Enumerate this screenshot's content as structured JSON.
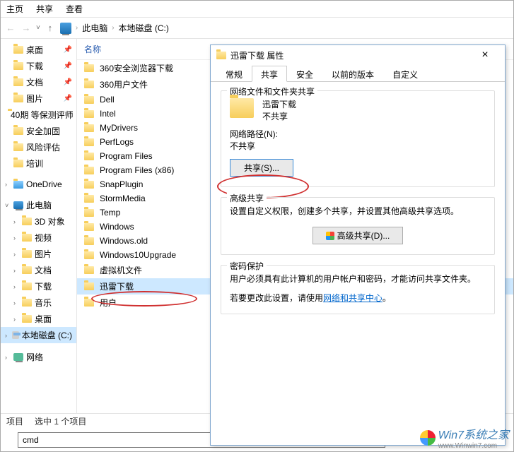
{
  "menubar": {
    "home": "主页",
    "share": "共享",
    "view": "查看"
  },
  "breadcrumb": {
    "this_pc": "此电脑",
    "drive": "本地磁盘 (C:)"
  },
  "nav": {
    "items": [
      {
        "label": "桌面",
        "pin": true
      },
      {
        "label": "下载",
        "pin": true
      },
      {
        "label": "文档",
        "pin": true
      },
      {
        "label": "图片",
        "pin": true
      },
      {
        "label": "40期 等保测评师",
        "pin": false
      },
      {
        "label": "安全加固",
        "pin": false
      },
      {
        "label": "风险评估",
        "pin": false
      },
      {
        "label": "培训",
        "pin": false
      }
    ],
    "onedrive": "OneDrive",
    "this_pc": "此电脑",
    "pc_children": [
      "3D 对象",
      "视频",
      "图片",
      "文档",
      "下载",
      "音乐",
      "桌面"
    ],
    "drive": "本地磁盘 (C:)",
    "network": "网络"
  },
  "list": {
    "header_name": "名称",
    "rows": [
      "360安全浏览器下载",
      "360用户文件",
      "Dell",
      "Intel",
      "MyDrivers",
      "PerfLogs",
      "Program Files",
      "Program Files (x86)",
      "SnapPlugin",
      "StormMedia",
      "Temp",
      "Windows",
      "Windows.old",
      "Windows10Upgrade",
      "虚拟机文件",
      "迅雷下载",
      "用户"
    ],
    "selected_index": 15
  },
  "status": {
    "items": "项目",
    "selection": "选中 1 个项目"
  },
  "cmd": {
    "value": "cmd"
  },
  "props": {
    "title": "迅雷下载 属性",
    "tabs": {
      "general": "常规",
      "share": "共享",
      "security": "安全",
      "prev": "以前的版本",
      "custom": "自定义"
    },
    "share_group": {
      "title": "网络文件和文件夹共享",
      "name": "迅雷下载",
      "state": "不共享",
      "path_label": "网络路径(N):",
      "path_value": "不共享",
      "share_btn": "共享(S)..."
    },
    "adv_group": {
      "title": "高级共享",
      "desc": "设置自定义权限，创建多个共享，并设置其他高级共享选项。",
      "btn": "高级共享(D)..."
    },
    "pwd_group": {
      "title": "密码保护",
      "line1": "用户必须具有此计算机的用户帐户和密码，才能访问共享文件夹。",
      "line2a": "若要更改此设置，请使用",
      "link": "网络和共享中心",
      "line2b": "。"
    }
  },
  "watermark": {
    "brand": "Win7系统之家",
    "url": "www.Winwin7.com"
  }
}
